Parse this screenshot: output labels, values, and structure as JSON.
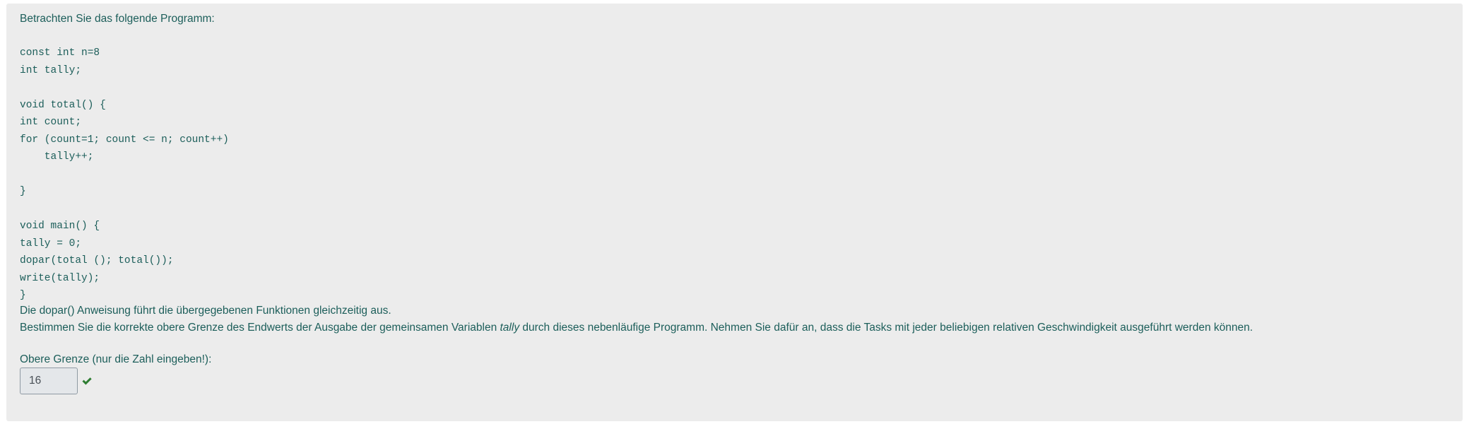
{
  "question": {
    "intro": "Betrachten Sie das folgende Programm:",
    "code_lines": [
      "const int n=8",
      "int tally;",
      "",
      "void total() {",
      "int count;",
      "for (count=1; count <= n; count++)",
      "    tally++;",
      "",
      "}",
      "",
      "void main() {",
      "tally = 0;",
      "dopar(total (); total());",
      "write(tally);",
      "}"
    ],
    "description_line1": "Die dopar() Anweisung führt die übergegebenen Funktionen gleichzeitig aus.",
    "description_line2_before": "Bestimmen Sie die korrekte obere Grenze des Endwerts der Ausgabe der gemeinsamen Variablen ",
    "description_line2_em": "tally",
    "description_line2_after": " durch dieses nebenläufige Programm. Nehmen Sie dafür an, dass die Tasks mit jeder beliebigen relativen Geschwindigkeit ausgeführt werden können."
  },
  "answer": {
    "label": "Obere Grenze (nur die Zahl eingeben!):",
    "value": "16",
    "status_icon": "check-icon",
    "status": "correct",
    "status_color": "#2e7d32"
  },
  "colors": {
    "text": "#1c5e5a",
    "card_background": "#ececec",
    "input_background": "#e4e7ea"
  }
}
